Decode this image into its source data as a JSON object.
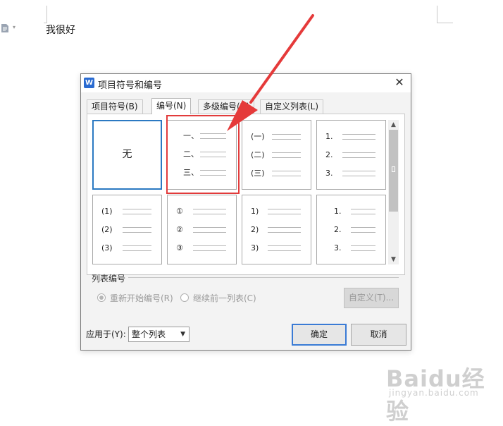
{
  "document": {
    "body_text": "我很好"
  },
  "dialog": {
    "title": "项目符号和编号",
    "app_icon_letter": "W",
    "tabs": [
      {
        "label": "项目符号(B)",
        "active": false
      },
      {
        "label": "编号(N)",
        "active": true
      },
      {
        "label": "多级编号(U)",
        "active": false
      },
      {
        "label": "自定义列表(L)",
        "active": false
      }
    ],
    "cells": [
      {
        "label": "无",
        "markers": []
      },
      {
        "label": "",
        "markers": [
          "一、",
          "二、",
          "三、"
        ]
      },
      {
        "label": "",
        "markers": [
          "(一)",
          "(二)",
          "(三)"
        ]
      },
      {
        "label": "",
        "markers": [
          "1.",
          "2.",
          "3."
        ]
      },
      {
        "label": "",
        "markers": [
          "(1)",
          "(2)",
          "(3)"
        ]
      },
      {
        "label": "",
        "markers": [
          "①",
          "②",
          "③"
        ]
      },
      {
        "label": "",
        "markers": [
          "1)",
          "2)",
          "3)"
        ]
      },
      {
        "label": "",
        "markers": [
          "1.",
          "2.",
          "3."
        ]
      }
    ],
    "list_numbering": {
      "group_label": "列表编号",
      "restart_label": "重新开始编号(R)",
      "continue_label": "继续前一列表(C)",
      "restart_selected": true,
      "custom_button_label": "自定义(T)..."
    },
    "apply_to": {
      "label": "应用于(Y):",
      "value": "整个列表"
    },
    "buttons": {
      "ok": "确定",
      "cancel": "取消"
    }
  },
  "annotations": {
    "highlight_color": "#e23b3b",
    "arrow_color": "#e53a3a"
  },
  "watermark": {
    "main": "Baidu经验",
    "sub": "jingyan.baidu.com"
  }
}
